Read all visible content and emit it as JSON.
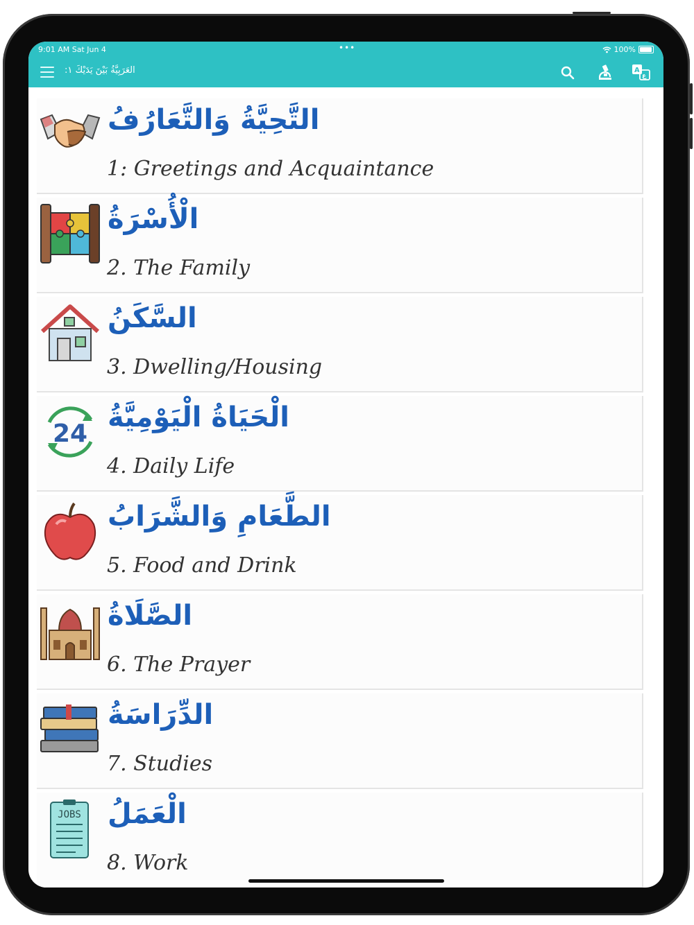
{
  "status_bar": {
    "time": "9:01 AM  Sat Jun 4",
    "dots": "•••",
    "battery": "100%"
  },
  "toolbar": {
    "title": "العَرَبِيَّةُ بَيْنَ يَدَيْكَ ١:",
    "colors": {
      "accent": "#2ec1c4"
    },
    "icons": [
      "menu-icon",
      "search-icon",
      "lab-icon",
      "translate-icon"
    ]
  },
  "lessons": [
    {
      "arabic": "التَّحِيَّةُ وَالتَّعَارُفُ",
      "english": "1: Greetings and Acquaintance",
      "icon": "handshake-icon"
    },
    {
      "arabic": "الْأُسْرَةُ",
      "english": "2. The Family",
      "icon": "puzzle-icon"
    },
    {
      "arabic": "السَّكَنُ",
      "english": "3. Dwelling/Housing",
      "icon": "house-icon"
    },
    {
      "arabic": "الْحَيَاةُ الْيَوْمِيَّةُ",
      "english": "4. Daily Life",
      "icon": "clock-24-icon",
      "icon_text": "24"
    },
    {
      "arabic": "الطَّعَامِ وَالشَّرَابُ",
      "english": "5. Food and Drink",
      "icon": "apple-icon"
    },
    {
      "arabic": "الصَّلَاةُ",
      "english": "6. The Prayer",
      "icon": "mosque-icon"
    },
    {
      "arabic": "الدِّرَاسَةُ",
      "english": "7. Studies",
      "icon": "books-icon"
    },
    {
      "arabic": "الْعَمَلُ",
      "english": "8. Work",
      "icon": "jobs-clipboard-icon",
      "icon_text": "JOBS"
    }
  ]
}
